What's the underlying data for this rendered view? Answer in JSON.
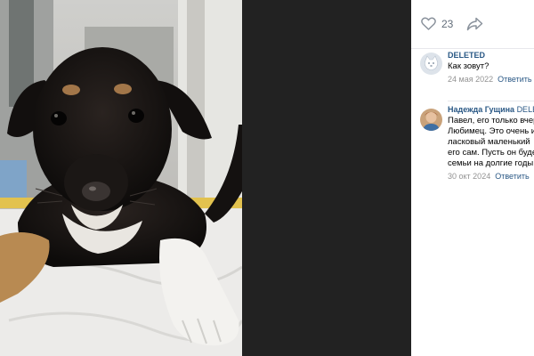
{
  "post": {
    "like_count": "23"
  },
  "comments": [
    {
      "author": "DELETED",
      "text_lines": [
        "Как зовут?"
      ],
      "date": "24 мая 2022",
      "reply_label": "Ответить"
    },
    {
      "author": "Надежда Гущина",
      "reply_to": "DELETED",
      "text_lines": [
        "Павел, его только вчера",
        "Любимец. Это очень и",
        "ласковый маленький",
        "его сам. Пусть он буде",
        "семьи на долгие годы"
      ],
      "date": "30 окт 2024",
      "reply_label": "Ответить"
    }
  ],
  "colors": {
    "link": "#2a5885",
    "muted": "#939393",
    "viewer_bg": "#222222"
  },
  "icons": [
    "heart-icon",
    "share-icon"
  ]
}
